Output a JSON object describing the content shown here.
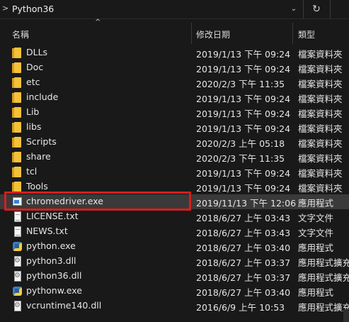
{
  "address": {
    "path": "Python36",
    "nav_arrow": ">",
    "dropdown_icon": "chevron-down-icon",
    "refresh_icon": "refresh-icon"
  },
  "columns": {
    "name": "名稱",
    "date": "修改日期",
    "type": "類型"
  },
  "files": [
    {
      "name": "DLLs",
      "date": "2019/1/13 下午 09:24",
      "type": "檔案資料夾",
      "icon": "folder"
    },
    {
      "name": "Doc",
      "date": "2019/1/13 下午 09:24",
      "type": "檔案資料夾",
      "icon": "folder"
    },
    {
      "name": "etc",
      "date": "2020/2/3 下午 11:35",
      "type": "檔案資料夾",
      "icon": "folder"
    },
    {
      "name": "include",
      "date": "2019/1/13 下午 09:24",
      "type": "檔案資料夾",
      "icon": "folder"
    },
    {
      "name": "Lib",
      "date": "2019/1/13 下午 09:24",
      "type": "檔案資料夾",
      "icon": "folder"
    },
    {
      "name": "libs",
      "date": "2019/1/13 下午 09:24",
      "type": "檔案資料夾",
      "icon": "folder"
    },
    {
      "name": "Scripts",
      "date": "2020/2/3 上午 05:18",
      "type": "檔案資料夾",
      "icon": "folder"
    },
    {
      "name": "share",
      "date": "2020/2/3 下午 11:35",
      "type": "檔案資料夾",
      "icon": "folder"
    },
    {
      "name": "tcl",
      "date": "2019/1/13 下午 09:24",
      "type": "檔案資料夾",
      "icon": "folder"
    },
    {
      "name": "Tools",
      "date": "2019/1/13 下午 09:24",
      "type": "檔案資料夾",
      "icon": "folder"
    },
    {
      "name": "chromedriver.exe",
      "date": "2019/11/13 下午 12:06",
      "type": "應用程式",
      "icon": "exe",
      "selected": true
    },
    {
      "name": "LICENSE.txt",
      "date": "2018/6/27 上午 03:43",
      "type": "文字文件",
      "icon": "doc"
    },
    {
      "name": "NEWS.txt",
      "date": "2018/6/27 上午 03:43",
      "type": "文字文件",
      "icon": "doc"
    },
    {
      "name": "python.exe",
      "date": "2018/6/27 上午 03:40",
      "type": "應用程式",
      "icon": "python"
    },
    {
      "name": "python3.dll",
      "date": "2018/6/27 上午 03:37",
      "type": "應用程式擴充",
      "icon": "dll"
    },
    {
      "name": "python36.dll",
      "date": "2018/6/27 上午 03:37",
      "type": "應用程式擴充",
      "icon": "dll"
    },
    {
      "name": "pythonw.exe",
      "date": "2018/6/27 上午 03:40",
      "type": "應用程式",
      "icon": "python"
    },
    {
      "name": "vcruntime140.dll",
      "date": "2016/6/9 上午 10:53",
      "type": "應用程式擴充",
      "icon": "dll"
    }
  ],
  "colors": {
    "background": "#191919",
    "selected_row": "#3a3a3a",
    "highlight_border": "#d51e1e",
    "folder": "#f3c13a"
  }
}
